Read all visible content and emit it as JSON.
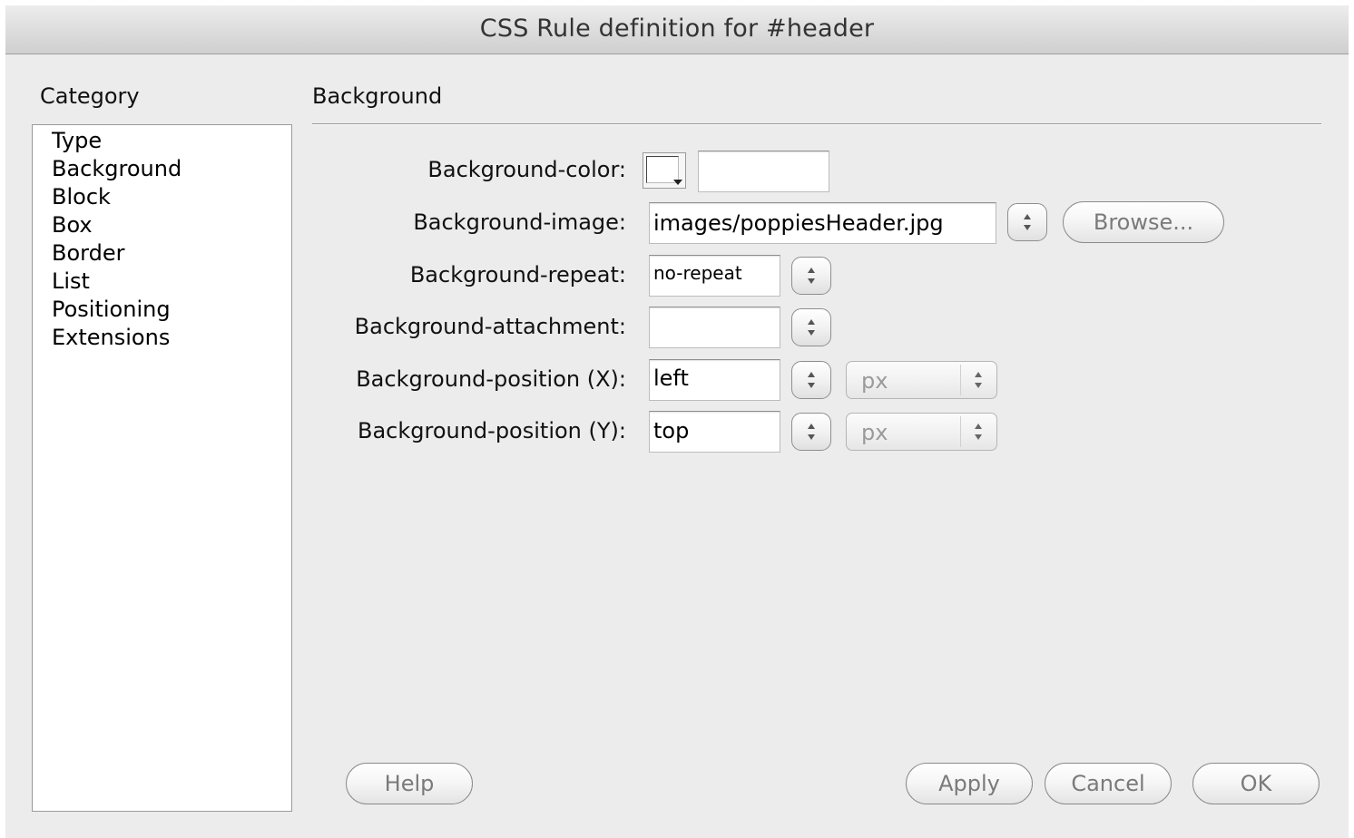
{
  "window": {
    "title": "CSS Rule definition for #header"
  },
  "category": {
    "heading": "Category",
    "items": [
      {
        "label": "Type"
      },
      {
        "label": "Background"
      },
      {
        "label": "Block"
      },
      {
        "label": "Box"
      },
      {
        "label": "Border"
      },
      {
        "label": "List"
      },
      {
        "label": "Positioning"
      },
      {
        "label": "Extensions"
      }
    ]
  },
  "panel": {
    "heading": "Background",
    "fields": {
      "bg_color": {
        "label": "Background-color:",
        "value": ""
      },
      "bg_image": {
        "label": "Background-image:",
        "value": "images/poppiesHeader.jpg",
        "browse_label": "Browse..."
      },
      "bg_repeat": {
        "label": "Background-repeat:",
        "value": "no-repeat"
      },
      "bg_attachment": {
        "label": "Background-attachment:",
        "value": ""
      },
      "bg_pos_x": {
        "label": "Background-position (X):",
        "value": "left",
        "unit": "px"
      },
      "bg_pos_y": {
        "label": "Background-position (Y):",
        "value": "top",
        "unit": "px"
      }
    }
  },
  "buttons": {
    "help": "Help",
    "apply": "Apply",
    "cancel": "Cancel",
    "ok": "OK"
  }
}
